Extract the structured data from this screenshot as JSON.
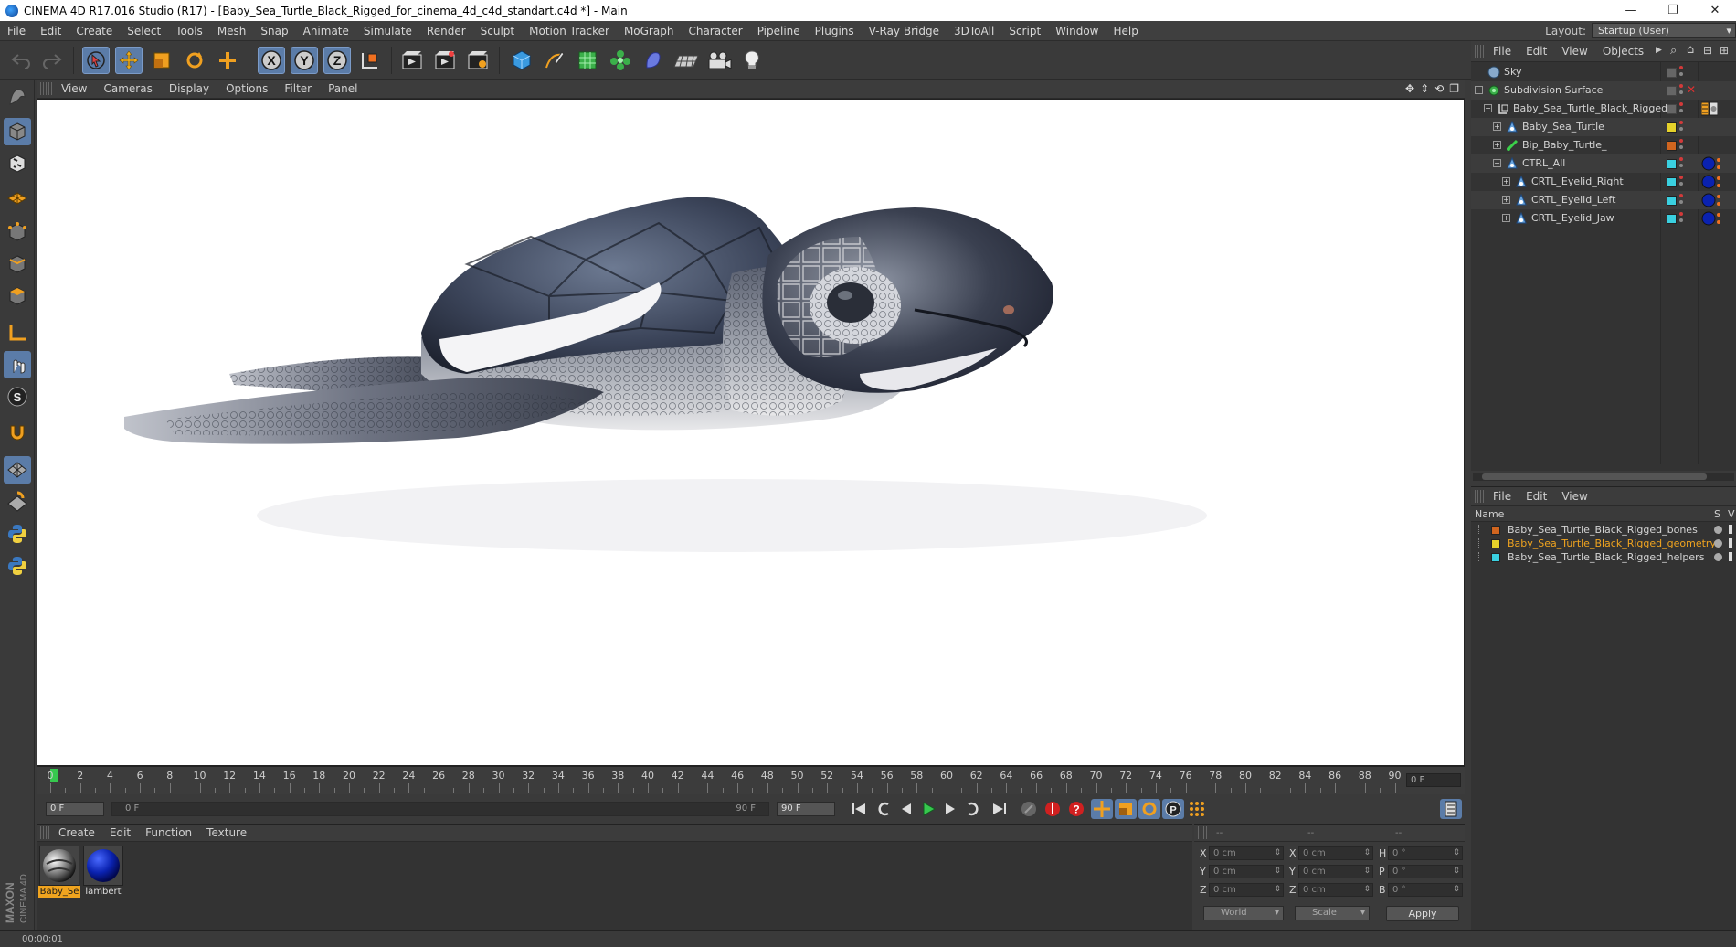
{
  "window": {
    "title": "CINEMA 4D R17.016 Studio (R17) - [Baby_Sea_Turtle_Black_Rigged_for_cinema_4d_c4d_standart.c4d *] - Main",
    "minimize": "—",
    "restore": "❐",
    "close": "✕"
  },
  "menubar": {
    "items": [
      "File",
      "Edit",
      "Create",
      "Select",
      "Tools",
      "Mesh",
      "Snap",
      "Animate",
      "Simulate",
      "Render",
      "Sculpt",
      "Motion Tracker",
      "MoGraph",
      "Character",
      "Pipeline",
      "Plugins",
      "V-Ray Bridge",
      "3DToAll",
      "Script",
      "Window",
      "Help"
    ],
    "layout_label": "Layout:",
    "layout_value": "Startup (User)"
  },
  "viewport": {
    "menu": [
      "View",
      "Cameras",
      "Display",
      "Options",
      "Filter",
      "Panel"
    ],
    "nav_icons": [
      "✥",
      "⇕",
      "⟲",
      "❐"
    ]
  },
  "timeline": {
    "ticks": [
      0,
      2,
      4,
      6,
      8,
      10,
      12,
      14,
      16,
      18,
      20,
      22,
      24,
      26,
      28,
      30,
      32,
      34,
      36,
      38,
      40,
      42,
      44,
      46,
      48,
      50,
      52,
      54,
      56,
      58,
      60,
      62,
      64,
      66,
      68,
      70,
      72,
      74,
      76,
      78,
      80,
      82,
      84,
      86,
      88,
      90
    ],
    "current_frame": 0,
    "end_field": "0 F"
  },
  "transport": {
    "start_field": "0 F",
    "range_start": "0 F",
    "range_end": "90 F",
    "end_field": "90 F"
  },
  "material_manager": {
    "menu": [
      "Create",
      "Edit",
      "Function",
      "Texture"
    ],
    "materials": [
      {
        "name": "Baby_Se",
        "selected": true
      },
      {
        "name": "lambert",
        "selected": false
      }
    ]
  },
  "coordinates": {
    "headers": [
      "--",
      "--",
      "--"
    ],
    "rows": [
      {
        "pos_label": "X",
        "pos": "0 cm",
        "size_label": "X",
        "size": "0 cm",
        "rot_label": "H",
        "rot": "0 °"
      },
      {
        "pos_label": "Y",
        "pos": "0 cm",
        "size_label": "Y",
        "size": "0 cm",
        "rot_label": "P",
        "rot": "0 °"
      },
      {
        "pos_label": "Z",
        "pos": "0 cm",
        "size_label": "Z",
        "size": "0 cm",
        "rot_label": "B",
        "rot": "0 °"
      }
    ],
    "space": "World",
    "mode": "Scale",
    "apply": "Apply"
  },
  "status": {
    "time": "00:00:01"
  },
  "object_manager": {
    "menu": [
      "File",
      "Edit",
      "View",
      "Objects"
    ],
    "objects": [
      {
        "name": "Sky",
        "indent": 0,
        "expander": "",
        "icon": "sky",
        "layer": "",
        "tag": ""
      },
      {
        "name": "Subdivision Surface",
        "indent": 0,
        "expander": "−",
        "icon": "subdiv",
        "layer": "",
        "tag": "",
        "x": true
      },
      {
        "name": "Baby_Sea_Turtle_Black_Rigged",
        "indent": 1,
        "expander": "−",
        "icon": "null",
        "layer": "",
        "tag": "texture"
      },
      {
        "name": "Baby_Sea_Turtle",
        "indent": 2,
        "expander": "+",
        "icon": "joint",
        "layer": "#e6d22a",
        "tag": ""
      },
      {
        "name": "Bip_Baby_Turtle_",
        "indent": 2,
        "expander": "+",
        "icon": "bone",
        "layer": "#d0651f",
        "tag": ""
      },
      {
        "name": "CTRL_All",
        "indent": 2,
        "expander": "−",
        "icon": "joint",
        "layer": "#3ad0e0",
        "tag": "material"
      },
      {
        "name": "CRTL_Eyelid_Right",
        "indent": 3,
        "expander": "+",
        "icon": "joint",
        "layer": "#3ad0e0",
        "tag": "material"
      },
      {
        "name": "CRTL_Eyelid_Left",
        "indent": 3,
        "expander": "+",
        "icon": "joint",
        "layer": "#3ad0e0",
        "tag": "material"
      },
      {
        "name": "CRTL_Eyelid_Jaw",
        "indent": 3,
        "expander": "+",
        "icon": "joint",
        "layer": "#3ad0e0",
        "tag": "material"
      }
    ]
  },
  "layer_manager": {
    "menu": [
      "File",
      "Edit",
      "View"
    ],
    "header_name": "Name",
    "header_s": "S",
    "header_v": "V",
    "layers": [
      {
        "name": "Baby_Sea_Turtle_Black_Rigged_bones",
        "color": "#d0651f",
        "selected": false
      },
      {
        "name": "Baby_Sea_Turtle_Black_Rigged_geometry",
        "color": "#e6d22a",
        "selected": true
      },
      {
        "name": "Baby_Sea_Turtle_Black_Rigged_helpers",
        "color": "#3ad0e0",
        "selected": false
      }
    ]
  },
  "brand": "MAXON CINEMA 4D",
  "colors": {
    "accent": "#5b7ca8",
    "selection": "#f0a41f",
    "play": "#36c84e"
  }
}
